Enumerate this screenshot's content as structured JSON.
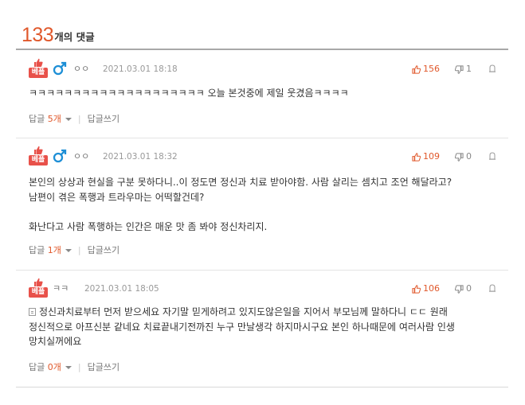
{
  "header": {
    "count": "133",
    "suffix": "개의 댓글"
  },
  "badge_label": "베플",
  "comments": [
    {
      "nick": "ㅇㅇ",
      "time": "2021.03.01 18:18",
      "up": "156",
      "down": "1",
      "text": "ㅋㅋㅋㅋㅋㅋㅋㅋㅋㅋㅋㅋㅋㅋㅋㅋㅋㅋㅋㅋ 오늘 본것중에 제일 웃겼음ㅋㅋㅋㅋ",
      "reply_label": "답글",
      "reply_count": "5개",
      "write_reply": "답글쓰기"
    },
    {
      "nick": "ㅇㅇ",
      "time": "2021.03.01 18:32",
      "up": "109",
      "down": "0",
      "text": "본인의 상상과 현실을 구분 못하다니..이 정도면 정신과 치료 받아야함. 사람 살리는 셈치고 조언 해달라고?\n남편이 겪은 폭행과 트라우마는 어떡할건데?\n\n화난다고 사람 폭행하는 인간은 매운 맛 좀 봐야 정신차리지.",
      "reply_label": "답글",
      "reply_count": "1개",
      "write_reply": "답글쓰기"
    },
    {
      "nick": "ㅋㅋ",
      "time": "2021.03.01 18:05",
      "up": "106",
      "down": "0",
      "text": "정신과치료부터 먼저 받으세요 자기말 믿게하려고 있지도않은일을 지어서 부모님께 말하다니 ㄷㄷ 원래\n정신적으로 아프신분 같네요 치료끝내기전까진 누구 만날생각 하지마시구요 본인 하나때문에 여러사람 인생\n망치실꺼에요",
      "reply_label": "답글",
      "reply_count": "0개",
      "write_reply": "답글쓰기"
    }
  ]
}
